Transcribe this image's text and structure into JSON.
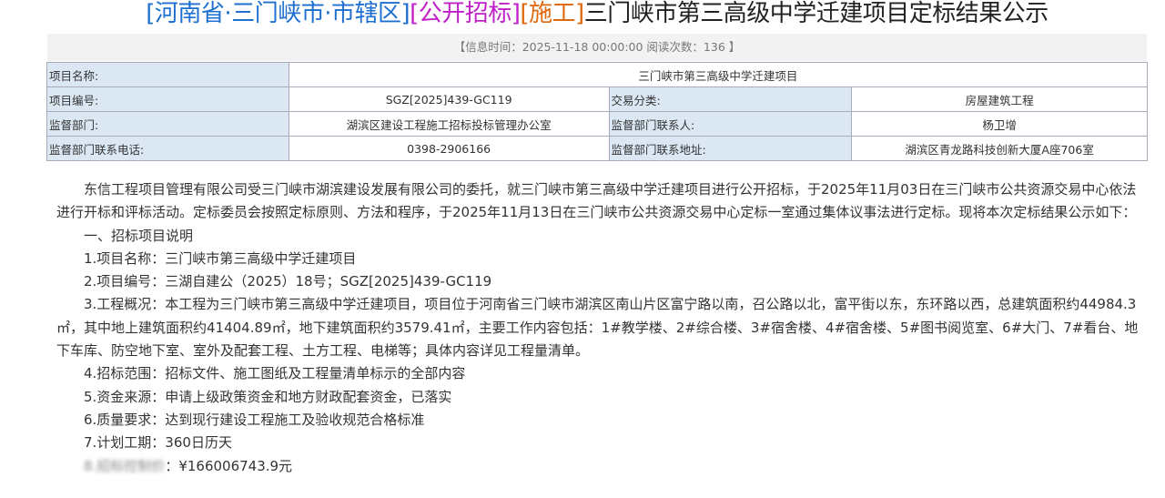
{
  "title": {
    "region": "[河南省·三门峡市·市辖区]",
    "type": "[公开招标]",
    "category": "[施工]",
    "name": "三门峡市第三高级中学迁建项目定标结果公示"
  },
  "meta": "【信息时间：2025-11-18 00:00:00   阅读次数：136 】",
  "table": {
    "project_name_label": "项目名称:",
    "project_name": "三门峡市第三高级中学迁建项目",
    "project_no_label": "项目编号:",
    "project_no": "SGZ[2025]439-GC119",
    "trade_type_label": "交易分类:",
    "trade_type": "房屋建筑工程",
    "supervisor_label": "监督部门:",
    "supervisor": "湖滨区建设工程施工招标投标管理办公室",
    "supervisor_contact_label": "监督部门联系人:",
    "supervisor_contact": "杨卫增",
    "phone_label": "监督部门联系电话:",
    "phone": "0398-2906166",
    "address_label": "监督部门联系地址:",
    "address": "湖滨区青龙路科技创新大厦A座706室"
  },
  "body": {
    "intro": "东信工程项目管理有限公司受三门峡市湖滨建设发展有限公司的委托，就三门峡市第三高级中学迁建项目进行公开招标，于2025年11月03日在三门峡市公共资源交易中心依法进行开标和评标活动。定标委员会按照定标原则、方法和程序，于2025年11月13日在三门峡市公共资源交易中心定标一室通过集体议事法进行定标。现将本次定标结果公示如下：",
    "section1": "一、招标项目说明",
    "items": [
      "1.项目名称：三门峡市第三高级中学迁建项目",
      "2.项目编号：三湖自建公（2025）18号；SGZ[2025]439-GC119",
      "3.工程概况：本工程为三门峡市第三高级中学迁建项目，项目位于河南省三门峡市湖滨区南山片区富宁路以南，召公路以北，富平街以东，东环路以西，总建筑面积约44984.3㎡，其中地上建筑面积约41404.89㎡，地下建筑面积约3579.41㎡，主要工作内容包括：1#教学楼、2#综合楼、3#宿舍楼、4#宿舍楼、5#图书阅览室、6#大门、7#看台、地下车库、防空地下室、室外及配套工程、土方工程、电梯等；具体内容详见工程量清单。",
      "4.招标范围：招标文件、施工图纸及工程量清单标示的全部内容",
      "5.资金来源：申请上级政策资金和地方财政配套资金，已落实",
      "6.质量要求：达到现行建设工程施工及验收规范合格标准",
      "7.计划工期：360日历天"
    ],
    "item8_label": "8.招标控制价",
    "item8_value": "：¥166006743.9元"
  }
}
